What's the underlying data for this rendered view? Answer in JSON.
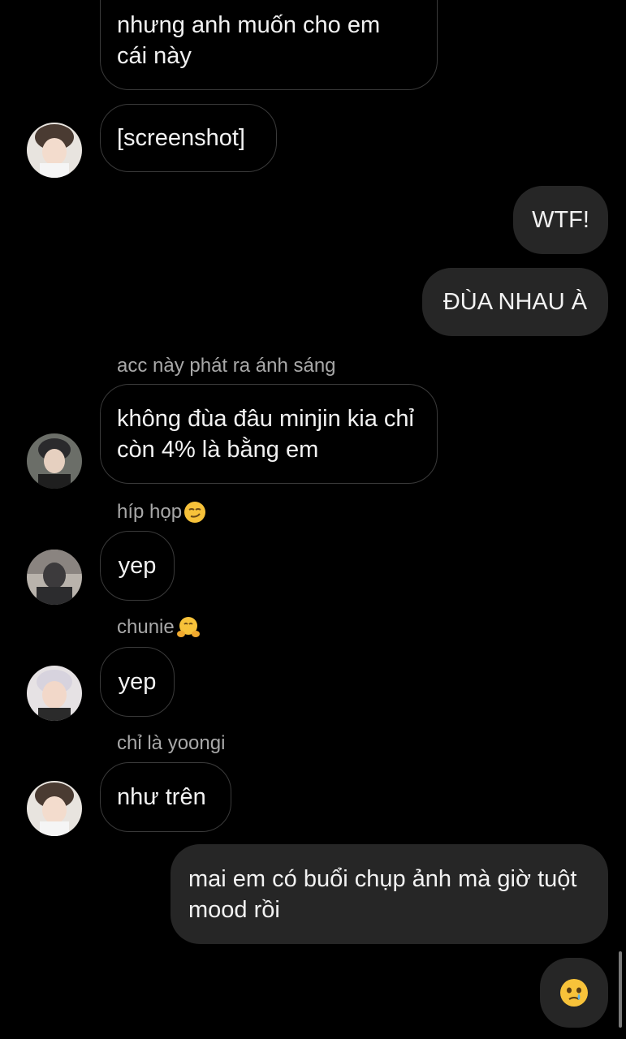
{
  "messages": {
    "m1": {
      "text": "nhưng anh muốn cho em cái này"
    },
    "m2": {
      "text": "[screenshot]"
    },
    "m3": {
      "text": "WTF!"
    },
    "m4": {
      "text": "ĐÙA NHAU À"
    },
    "m5": {
      "sender": "acc này phát ra ánh sáng",
      "text": "không đùa đâu minjin kia chỉ còn 4% là bằng em"
    },
    "m6": {
      "sender": "híp họp",
      "sender_emoji": "smirking-face-emoji",
      "text": "yep"
    },
    "m7": {
      "sender": "chunie",
      "sender_emoji": "hugging-face-emoji",
      "text": "yep"
    },
    "m8": {
      "sender": "chỉ là yoongi",
      "text": "như trên"
    },
    "m9": {
      "text": "mai em có buổi chụp ảnh mà giờ tuột mood rồi"
    },
    "m10": {
      "emoji": "face-holding-back-tears-emoji"
    }
  },
  "colors": {
    "background": "#000000",
    "incoming_border": "#3a3a3a",
    "outgoing_fill": "#262626",
    "sender_text": "#a8a8a8",
    "message_text": "#f2f2f2"
  }
}
